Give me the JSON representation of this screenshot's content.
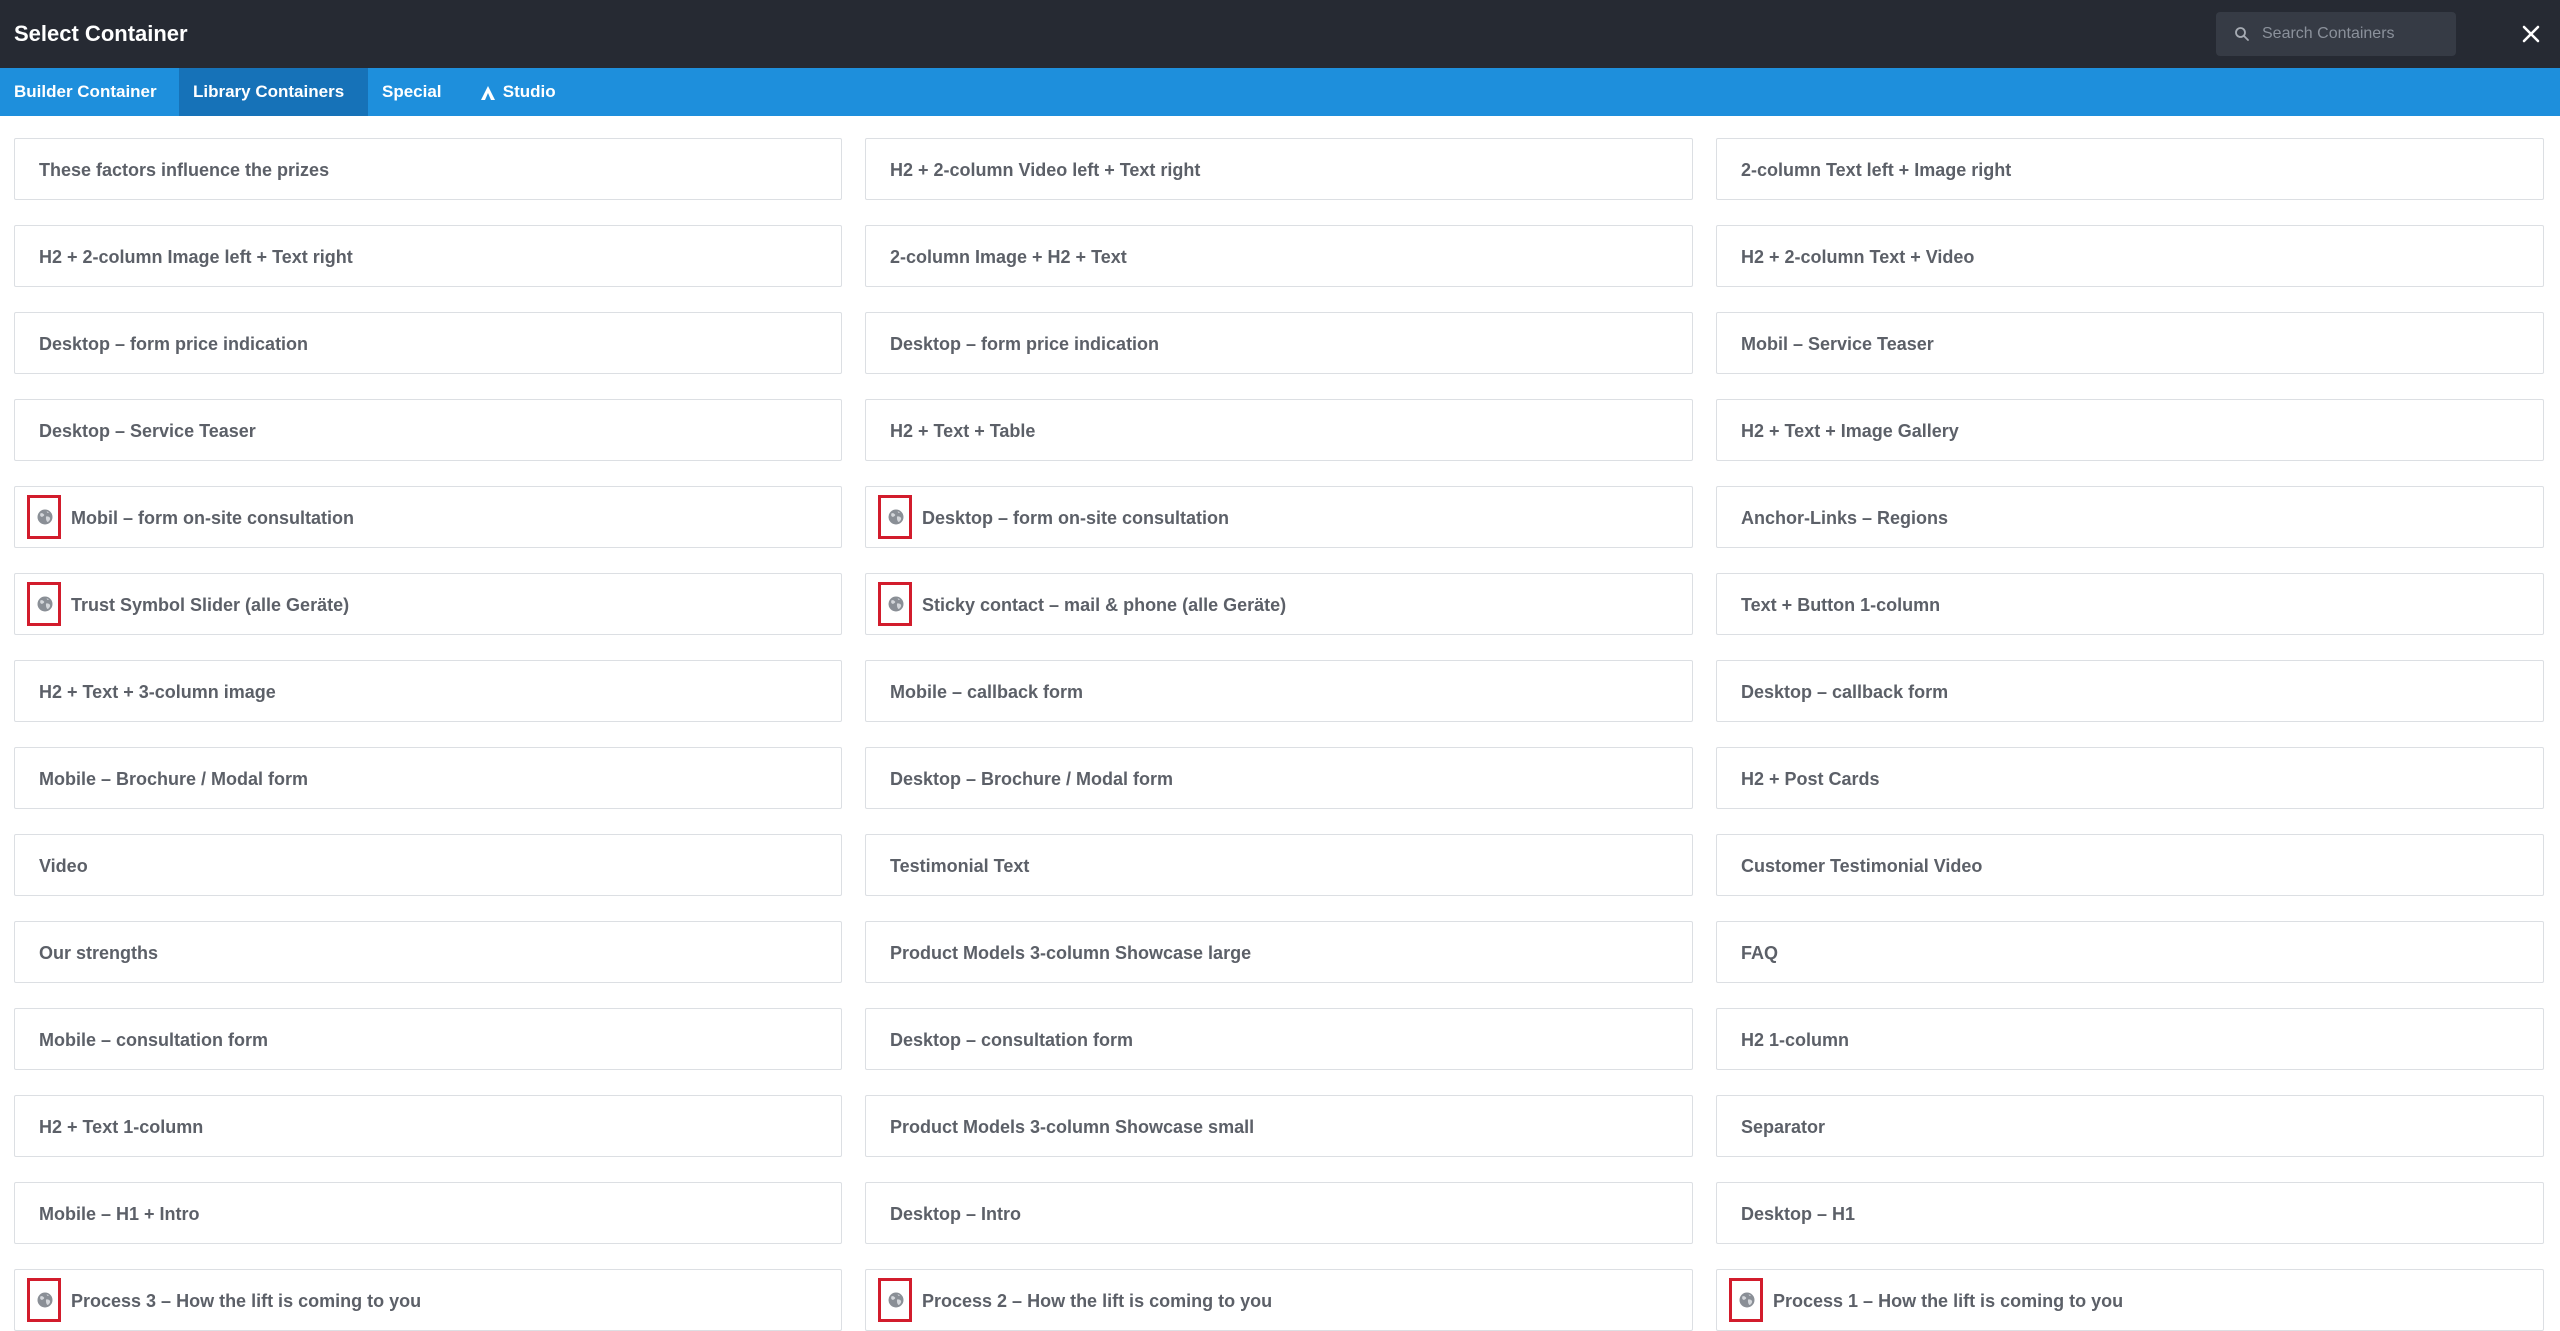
{
  "header": {
    "title": "Select Container",
    "search_placeholder": "Search Containers",
    "search_value": "",
    "close_label": "✕"
  },
  "tabs": [
    {
      "label": "Builder Container",
      "active": false
    },
    {
      "label": "Library Containers",
      "active": true
    },
    {
      "label": "Special",
      "active": false
    },
    {
      "label": "Studio",
      "active": false,
      "icon": "studio-logo-icon"
    }
  ],
  "containers": [
    [
      {
        "label": "These factors influence the prizes",
        "globe": false
      },
      {
        "label": "H2 + 2-column Image left + Text right",
        "globe": false
      },
      {
        "label": "Desktop – form price indication",
        "globe": false
      },
      {
        "label": "Desktop – Service Teaser",
        "globe": false
      },
      {
        "label": "Mobil – form on-site consultation",
        "globe": true
      },
      {
        "label": "Trust Symbol Slider (alle Geräte)",
        "globe": true
      },
      {
        "label": "H2 + Text + 3-column image",
        "globe": false
      },
      {
        "label": "Mobile – Brochure / Modal form",
        "globe": false
      },
      {
        "label": "Video",
        "globe": false
      },
      {
        "label": "Our strengths",
        "globe": false
      },
      {
        "label": "Mobile – consultation form",
        "globe": false
      },
      {
        "label": "H2 + Text 1-column",
        "globe": false
      },
      {
        "label": "Mobile – H1 + Intro",
        "globe": false
      },
      {
        "label": "Process 3 – How the lift is coming to you",
        "globe": true
      }
    ],
    [
      {
        "label": "H2 + 2-column Video left + Text right",
        "globe": false
      },
      {
        "label": "2-column Image + H2 + Text",
        "globe": false
      },
      {
        "label": "Desktop – form price indication",
        "globe": false
      },
      {
        "label": "H2 + Text + Table",
        "globe": false
      },
      {
        "label": "Desktop – form on-site consultation",
        "globe": true
      },
      {
        "label": "Sticky contact – mail & phone (alle Geräte)",
        "globe": true
      },
      {
        "label": "Mobile – callback form",
        "globe": false
      },
      {
        "label": "Desktop – Brochure / Modal form",
        "globe": false
      },
      {
        "label": "Testimonial Text",
        "globe": false
      },
      {
        "label": "Product Models 3-column Showcase large",
        "globe": false
      },
      {
        "label": "Desktop – consultation form",
        "globe": false
      },
      {
        "label": "Product Models 3-column Showcase small",
        "globe": false
      },
      {
        "label": "Desktop – Intro",
        "globe": false
      },
      {
        "label": "Process 2 – How the lift is coming to you",
        "globe": true
      }
    ],
    [
      {
        "label": "2-column Text left + Image right",
        "globe": false
      },
      {
        "label": "H2 + 2-column Text + Video",
        "globe": false
      },
      {
        "label": "Mobil – Service Teaser",
        "globe": false
      },
      {
        "label": "H2 + Text + Image Gallery",
        "globe": false
      },
      {
        "label": "Anchor-Links – Regions",
        "globe": false
      },
      {
        "label": "Text + Button 1-column",
        "globe": false
      },
      {
        "label": "Desktop – callback form",
        "globe": false
      },
      {
        "label": "H2 + Post Cards",
        "globe": false
      },
      {
        "label": "Customer Testimonial Video",
        "globe": false
      },
      {
        "label": "FAQ",
        "globe": false
      },
      {
        "label": "H2 1-column",
        "globe": false
      },
      {
        "label": "Separator",
        "globe": false
      },
      {
        "label": "Desktop – H1",
        "globe": false
      },
      {
        "label": "Process 1 – How the lift is coming to you",
        "globe": true
      }
    ]
  ],
  "colors": {
    "header_bg": "#262a33",
    "tabbar_bg": "#1e8fdc",
    "tab_active_bg": "#1672b8",
    "highlight_border": "#d21c2c",
    "card_text": "#5c6068"
  }
}
